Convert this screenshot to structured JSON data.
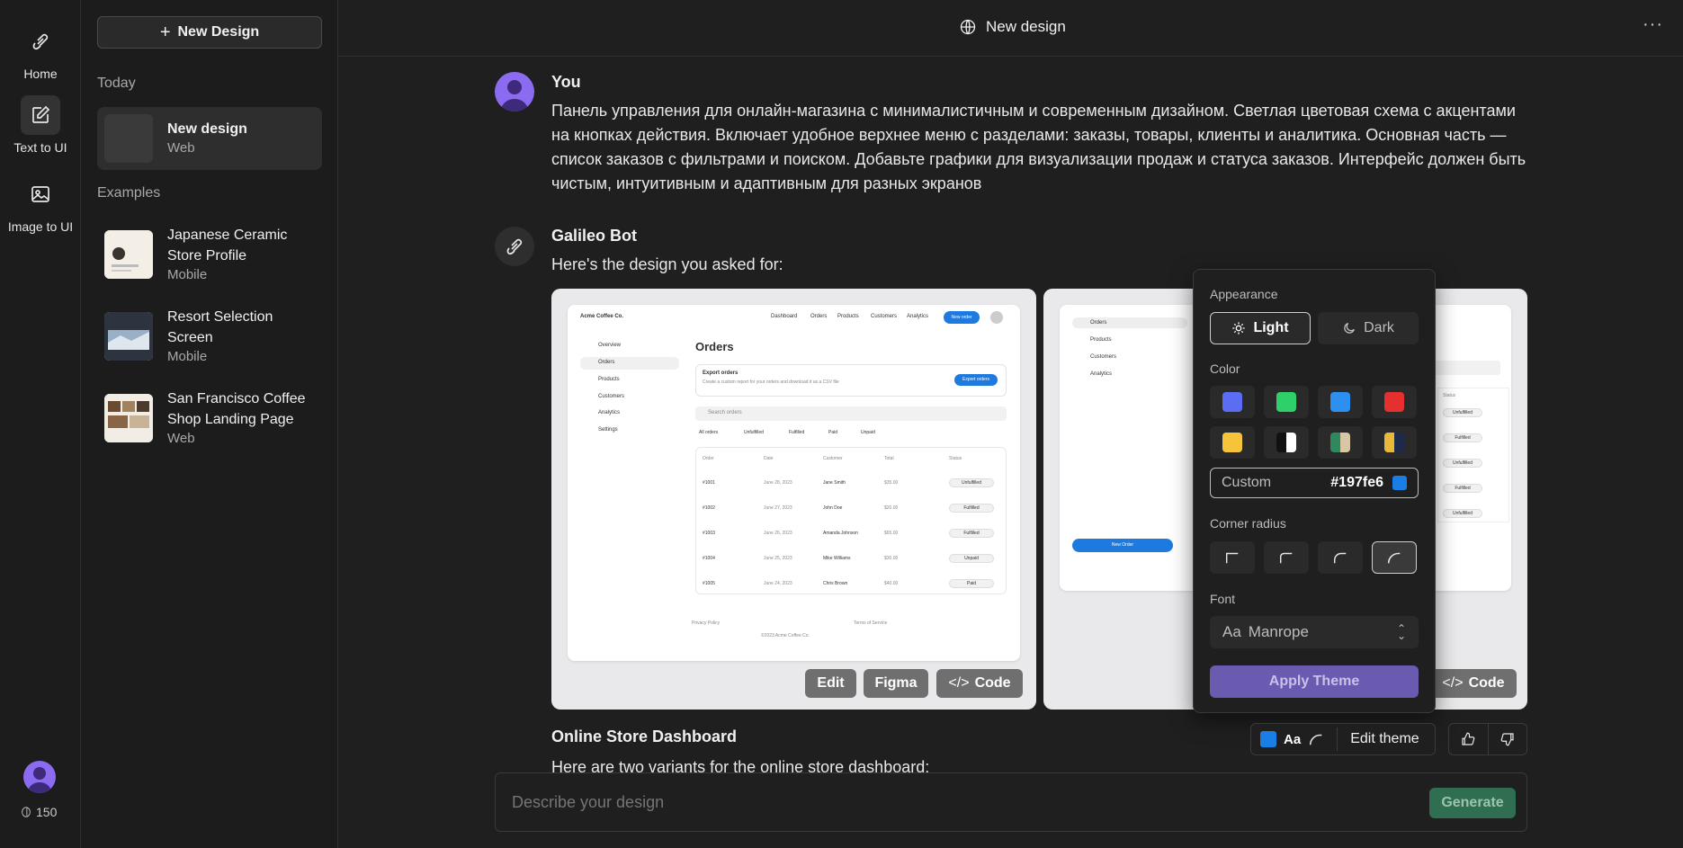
{
  "rail": {
    "home": "Home",
    "text_to_ui": "Text to UI",
    "image_to_ui": "Image to UI",
    "credits": "150"
  },
  "sidebar": {
    "new_design": "New Design",
    "today_label": "Today",
    "history": [
      {
        "title": "New design",
        "sub": "Web"
      }
    ],
    "examples_label": "Examples",
    "examples": [
      {
        "title": "Japanese Ceramic Store Profile",
        "sub": "Mobile"
      },
      {
        "title": "Resort Selection Screen",
        "sub": "Mobile"
      },
      {
        "title": "San Francisco Coffee Shop Landing Page",
        "sub": "Web"
      }
    ]
  },
  "header": {
    "title": "New design",
    "more": "⋮"
  },
  "chat": {
    "you_name": "You",
    "you_text": "Панель управления для онлайн-магазина с минималистичным и современным дизайном. Светлая цветовая схема с акцентами на кнопках действия. Включает удобное верхнее меню с разделами: заказы, товары, клиенты и аналитика. Основная часть — список заказов с фильтрами и поиском. Добавьте графики для визуализации продаж и статуса заказов. Интерфейс должен быть чистым, интуитивным и адаптивным для разных экранов",
    "bot_name": "Galileo Bot",
    "bot_text": "Here's the design you asked for:",
    "result_title": "Online Store Dashboard",
    "result_sub": "Here are two variants for the online store dashboard:"
  },
  "preview1": {
    "brand": "Acme Coffee Co.",
    "nav": [
      "Dashboard",
      "Orders",
      "Products",
      "Customers",
      "Analytics"
    ],
    "new_order": "New order",
    "side": [
      "Overview",
      "Orders",
      "Products",
      "Customers",
      "Analytics",
      "Settings"
    ],
    "heading": "Orders",
    "export_title": "Export orders",
    "export_sub": "Create a custom report for your orders and download it as a CSV file",
    "export_btn": "Export orders",
    "search": "Search orders",
    "filters": [
      "All orders",
      "Unfulfilled",
      "Fulfilled",
      "Paid",
      "Unpaid"
    ],
    "columns": [
      "Order",
      "Date",
      "Customer",
      "Total",
      "Status"
    ],
    "rows": [
      [
        "#1001",
        "June 28, 2023",
        "Jane Smith",
        "$35.00",
        "Unfulfilled"
      ],
      [
        "#1002",
        "June 27, 2023",
        "John Doe",
        "$20.00",
        "Fulfilled"
      ],
      [
        "#1003",
        "June 26, 2023",
        "Amanda Johnson",
        "$65.00",
        "Fulfilled"
      ],
      [
        "#1004",
        "June 25, 2023",
        "Mike Williams",
        "$30.00",
        "Unpaid"
      ],
      [
        "#1005",
        "June 24, 2023",
        "Chris Brown",
        "$40.00",
        "Paid"
      ]
    ],
    "footer_links": [
      "Privacy Policy",
      "Terms of Service"
    ],
    "copyright": "©2023 Acme Coffee Co."
  },
  "preview2": {
    "side": [
      "Orders",
      "Products",
      "Customers",
      "Analytics"
    ],
    "new_order": "New Order",
    "status_col": "Status",
    "statuses": [
      "Unfulfilled",
      "Fulfilled",
      "Unfulfilled",
      "Fulfilled",
      "Unfulfilled"
    ]
  },
  "card_actions": {
    "edit": "Edit",
    "figma": "Figma",
    "code": "Code"
  },
  "theme": {
    "appearance_label": "Appearance",
    "light": "Light",
    "dark": "Dark",
    "color_label": "Color",
    "colors": [
      "#5b6cf5",
      "#2fcf6a",
      "#2d8ff0",
      "#e5302f",
      "#f5c43a"
    ],
    "custom_label": "Custom",
    "custom_hex": "#197fe6",
    "corner_label": "Corner radius",
    "font_label": "Font",
    "font_value": "Manrope",
    "font_prefix": "Aa",
    "apply": "Apply Theme",
    "edit_theme": "Edit theme"
  },
  "composer": {
    "placeholder": "Describe your design",
    "generate": "Generate"
  }
}
